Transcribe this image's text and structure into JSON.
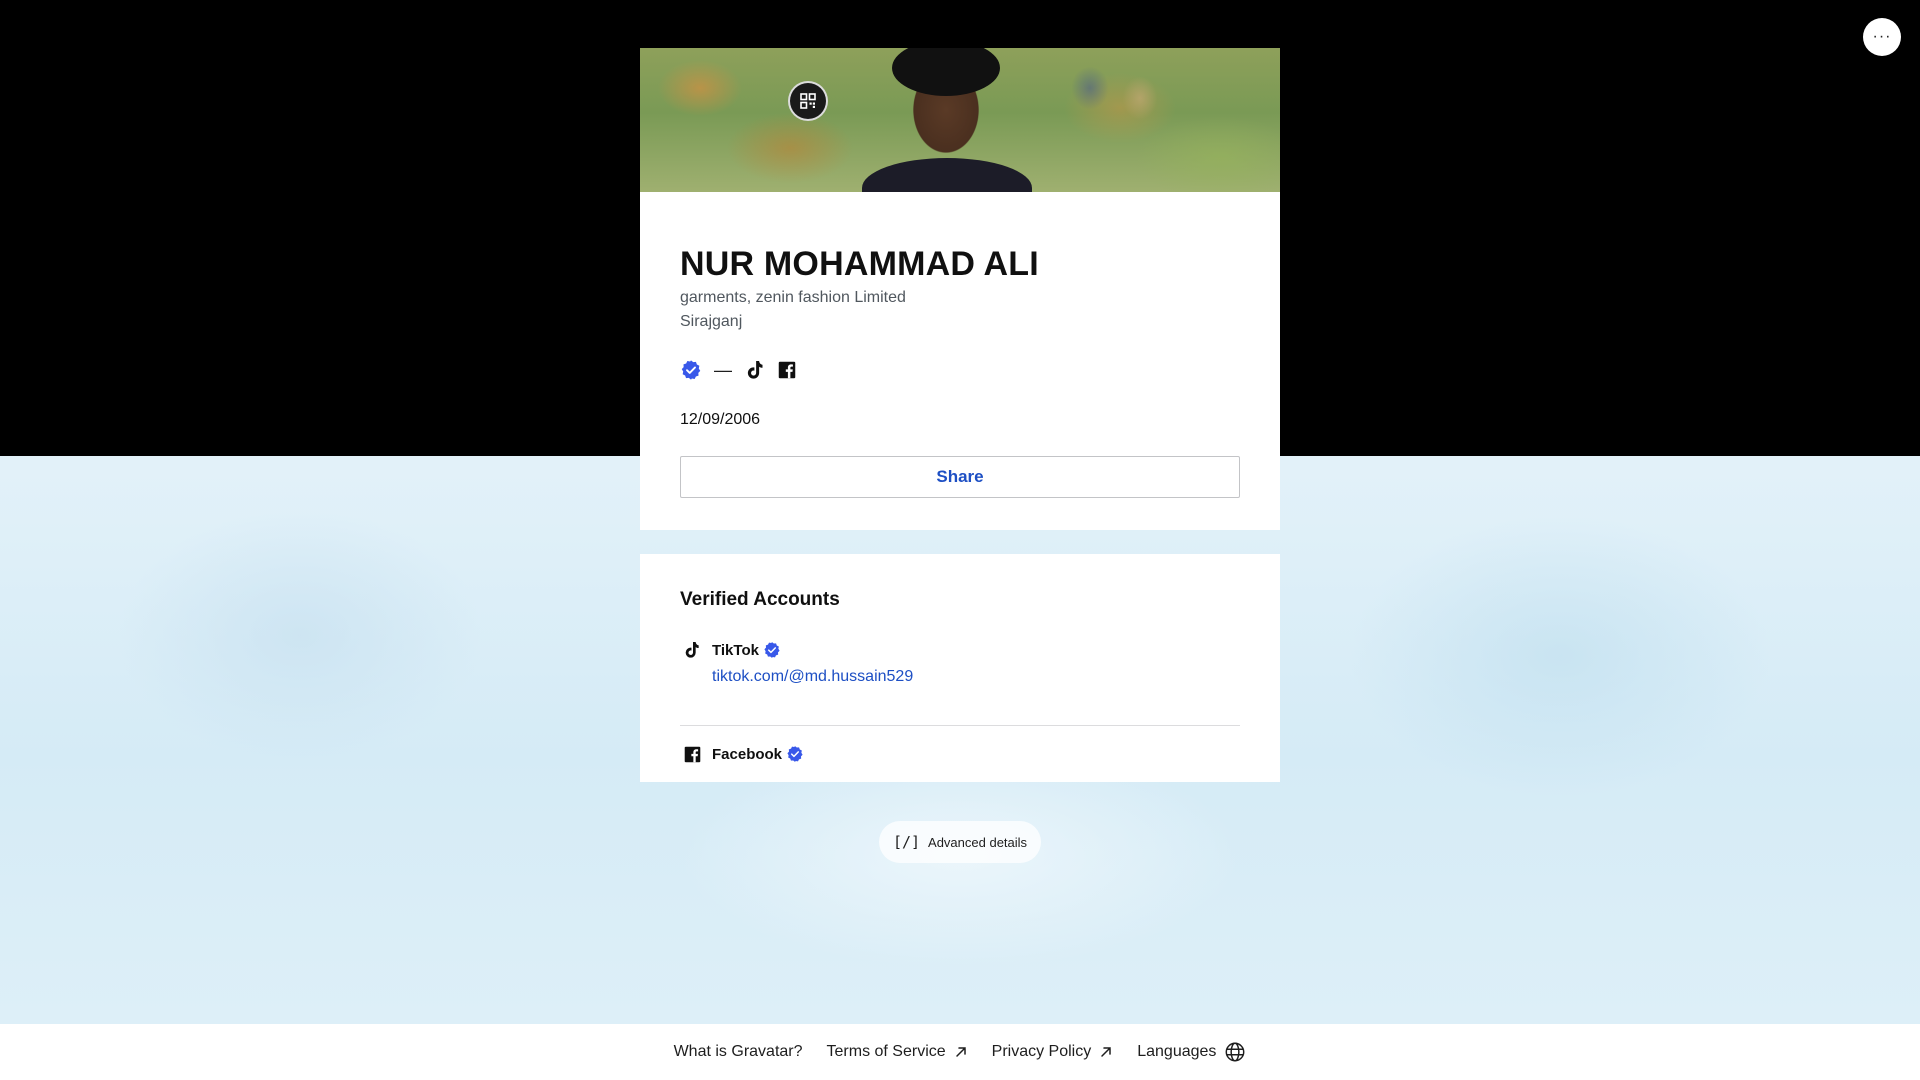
{
  "profile": {
    "name": "NUR MOHAMMAD ALI",
    "job": "garments, zenin fashion Limited",
    "location": "Sirajganj",
    "date": "12/09/2006",
    "share_label": "Share",
    "header_icons": [
      "verified-badge-icon",
      "em-dash",
      "tiktok-icon",
      "facebook-icon"
    ],
    "header_dash": "—"
  },
  "verified": {
    "title": "Verified Accounts",
    "accounts": [
      {
        "name": "TikTok",
        "link": "tiktok.com/@md.hussain529",
        "icon": "tiktok-icon",
        "verified": true
      },
      {
        "name": "Facebook",
        "icon": "facebook-icon",
        "verified": true
      }
    ]
  },
  "advanced": {
    "icon_text": "[/]",
    "label": "Advanced details"
  },
  "footer": {
    "links": [
      {
        "label": "What is Gravatar?"
      },
      {
        "label": "Terms of Service",
        "icon": "external-arrow-icon"
      },
      {
        "label": "Privacy Policy",
        "icon": "external-arrow-icon"
      },
      {
        "label": "Languages",
        "icon": "globe-icon"
      }
    ]
  },
  "menu": {
    "label": "···"
  },
  "colors": {
    "accent": "#1d4fc4",
    "verified": "#3858e9",
    "top_band": "#000000"
  }
}
